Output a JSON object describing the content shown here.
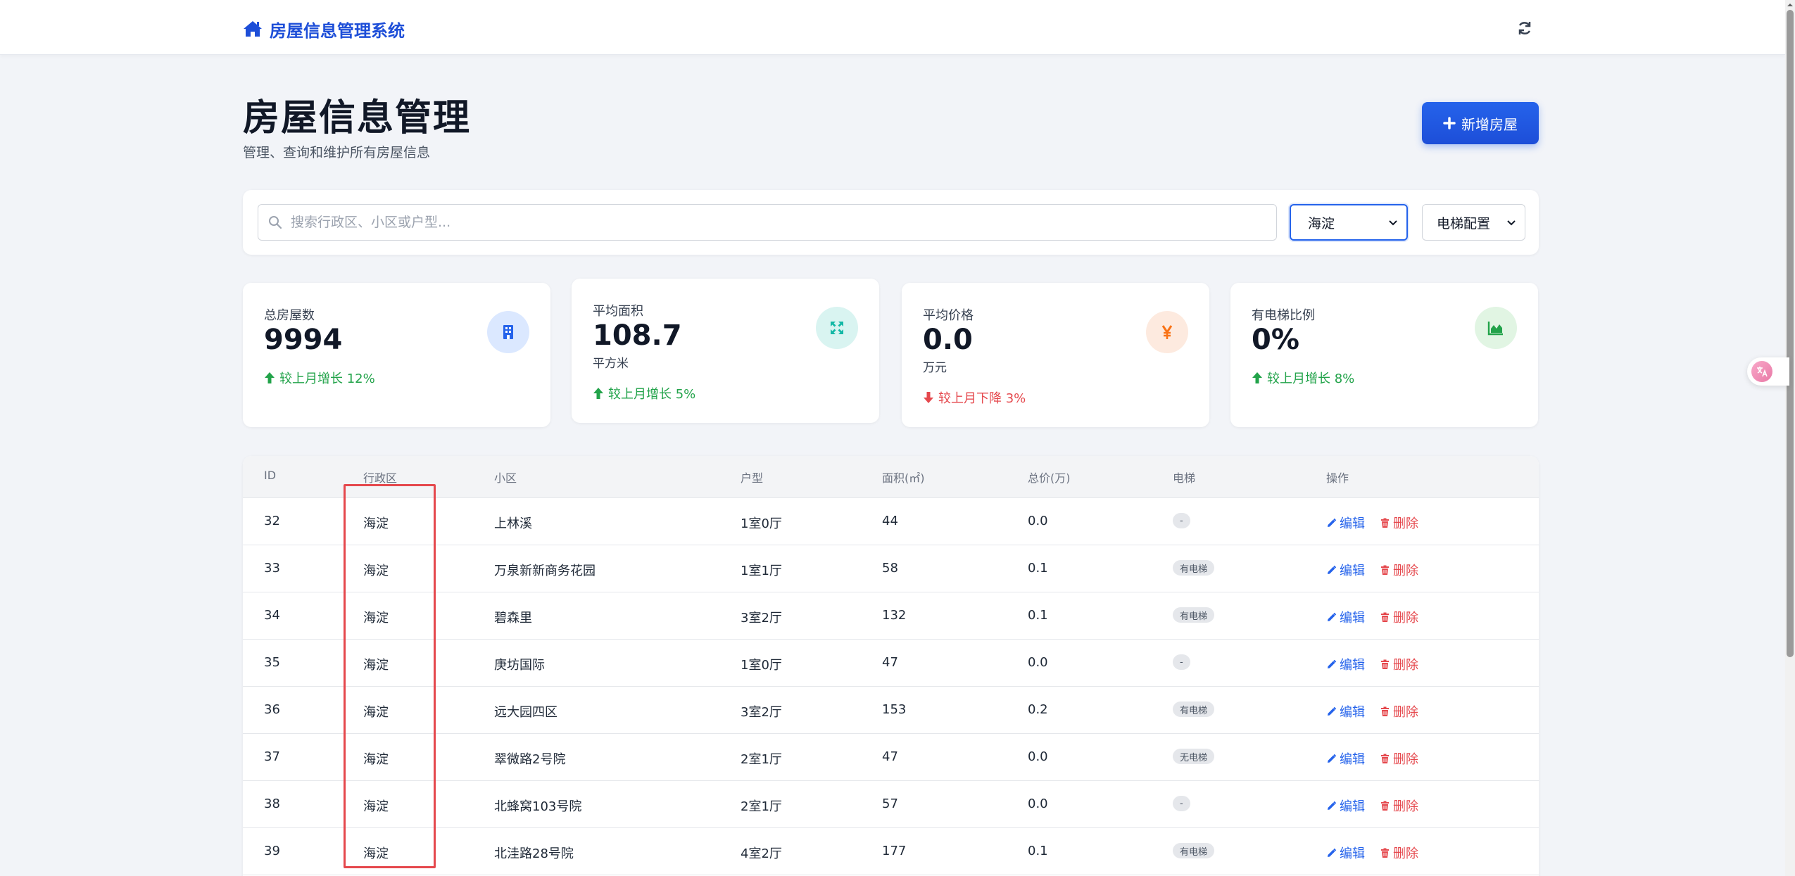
{
  "nav": {
    "brand": "房屋信息管理系统",
    "brand_icon": "home-icon",
    "refresh_icon": "refresh-icon"
  },
  "header": {
    "title": "房屋信息管理",
    "subtitle": "管理、查询和维护所有房屋信息",
    "add_button": "新增房屋"
  },
  "filters": {
    "search_placeholder": "搜索行政区、小区或户型...",
    "district_selected": "海淀",
    "elevator_selected": "电梯配置"
  },
  "stats": [
    {
      "label": "总房屋数",
      "value": "9994",
      "unit": "",
      "trend": "较上月增长 12%",
      "direction": "up",
      "icon": "building-icon",
      "color": "#2563eb"
    },
    {
      "label": "平均面积",
      "value": "108.7",
      "unit": "平方米",
      "trend": "较上月增长 5%",
      "direction": "up",
      "icon": "expand-icon",
      "color": "#14b8a6"
    },
    {
      "label": "平均价格",
      "value": "0.0",
      "unit": "万元",
      "trend": "较上月下降 3%",
      "direction": "down",
      "icon": "yen-icon",
      "color": "#f97316"
    },
    {
      "label": "有电梯比例",
      "value": "0%",
      "unit": "",
      "trend": "较上月增长 8%",
      "direction": "up",
      "icon": "area-chart-icon",
      "color": "#22a34a"
    }
  ],
  "table": {
    "headers": [
      "ID",
      "行政区",
      "小区",
      "户型",
      "面积(㎡)",
      "总价(万)",
      "电梯",
      "操作"
    ],
    "edit_label": "编辑",
    "delete_label": "删除",
    "rows": [
      {
        "id": "32",
        "district": "海淀",
        "community": "上林溪",
        "layout": "1室0厅",
        "area": "44",
        "price": "0.0",
        "elevator": "-"
      },
      {
        "id": "33",
        "district": "海淀",
        "community": "万泉新新商务花园",
        "layout": "1室1厅",
        "area": "58",
        "price": "0.1",
        "elevator": "有电梯"
      },
      {
        "id": "34",
        "district": "海淀",
        "community": "碧森里",
        "layout": "3室2厅",
        "area": "132",
        "price": "0.1",
        "elevator": "有电梯"
      },
      {
        "id": "35",
        "district": "海淀",
        "community": "庚坊国际",
        "layout": "1室0厅",
        "area": "47",
        "price": "0.0",
        "elevator": "-"
      },
      {
        "id": "36",
        "district": "海淀",
        "community": "远大园四区",
        "layout": "3室2厅",
        "area": "153",
        "price": "0.2",
        "elevator": "有电梯"
      },
      {
        "id": "37",
        "district": "海淀",
        "community": "翠微路2号院",
        "layout": "2室1厅",
        "area": "47",
        "price": "0.0",
        "elevator": "无电梯"
      },
      {
        "id": "38",
        "district": "海淀",
        "community": "北蜂窝103号院",
        "layout": "2室1厅",
        "area": "57",
        "price": "0.0",
        "elevator": "-"
      },
      {
        "id": "39",
        "district": "海淀",
        "community": "北洼路28号院",
        "layout": "4室2厅",
        "area": "177",
        "price": "0.1",
        "elevator": "有电梯"
      }
    ]
  }
}
